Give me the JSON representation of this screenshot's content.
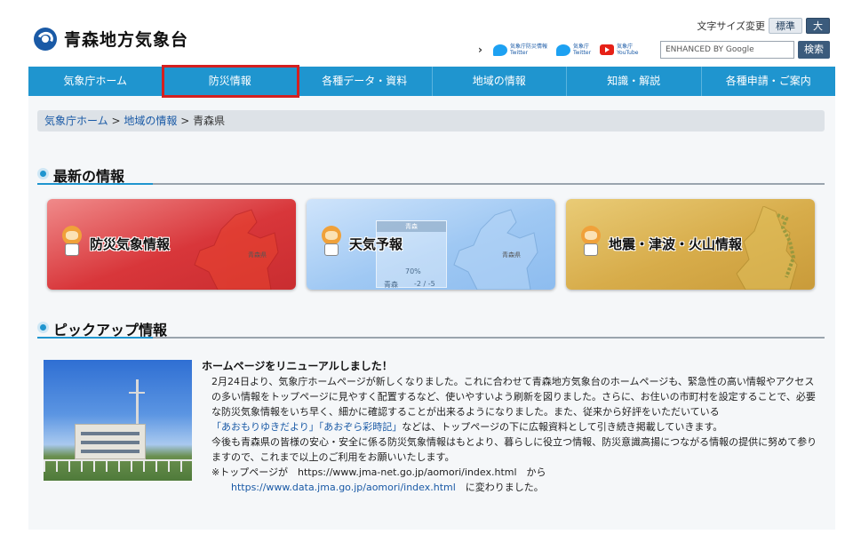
{
  "header": {
    "site_title": "青森地方気象台",
    "font_size_label": "文字サイズ変更",
    "font_size_std": "標準",
    "font_size_large": "大",
    "social": [
      {
        "icon": "twitter-icon",
        "line1": "気象庁防災情報",
        "line2": "Twitter"
      },
      {
        "icon": "twitter-icon",
        "line1": "気象庁",
        "line2": "Twitter"
      },
      {
        "icon": "youtube-icon",
        "line1": "気象庁",
        "line2": "YouTube"
      }
    ],
    "search_placeholder": "ENHANCED BY Google",
    "search_button": "検索"
  },
  "nav": {
    "items": [
      "気象庁ホーム",
      "防災情報",
      "各種データ・資料",
      "地域の情報",
      "知識・解説",
      "各種申請・ご案内"
    ]
  },
  "breadcrumb": {
    "home": "気象庁ホーム",
    "region": "地域の情報",
    "current": "青森県",
    "sep": ">"
  },
  "latest": {
    "heading": "最新の情報",
    "cards": [
      {
        "label": "防災気象情報",
        "map_city": "青森県"
      },
      {
        "label": "天気予報",
        "panel_header": "青森",
        "panel_pct": "70%",
        "panel_city": "青森",
        "panel_temp": "-2 / -5",
        "map_city": "青森県"
      },
      {
        "label": "地震・津波・火山情報"
      }
    ]
  },
  "pickup": {
    "heading": "ピックアップ情報",
    "title": "ホームページをリニューアルしました！",
    "para1_a": "2月24日より、気象庁ホームページが新しくなりました。これに合わせて青森地方気象台のホームページも、緊急性の高い情報やアクセスの多い情報をトップページに見やすく配置するなど、使いやすいよう刷新を図りました。さらに、お住いの市町村を設定することで、必要な防災気象情報をいち早く、細かに確認することが出来るようになりました。また、従来から好評をいただいている",
    "link1": "「あおもりゆきだより」",
    "link2": "「あおぞら彩時記」",
    "para1_b": "などは、トップページの下に広報資料として引き続き掲載していきます。",
    "para2": "今後も青森県の皆様の安心・安全に係る防災気象情報はもとより、暮らしに役立つ情報、防災意識高揚につながる情報の提供に努めて参りますので、これまで以上のご利用をお願いいたします。",
    "note_a": "※トップページが　https://www.jma-net.go.jp/aomori/index.html　から",
    "note_link": "https://www.data.jma.go.jp/aomori/index.html",
    "note_b": "　に変わりました。"
  },
  "colors": {
    "nav_bg": "#1f95cf",
    "highlight": "#d42020",
    "link": "#1a5aa6"
  }
}
